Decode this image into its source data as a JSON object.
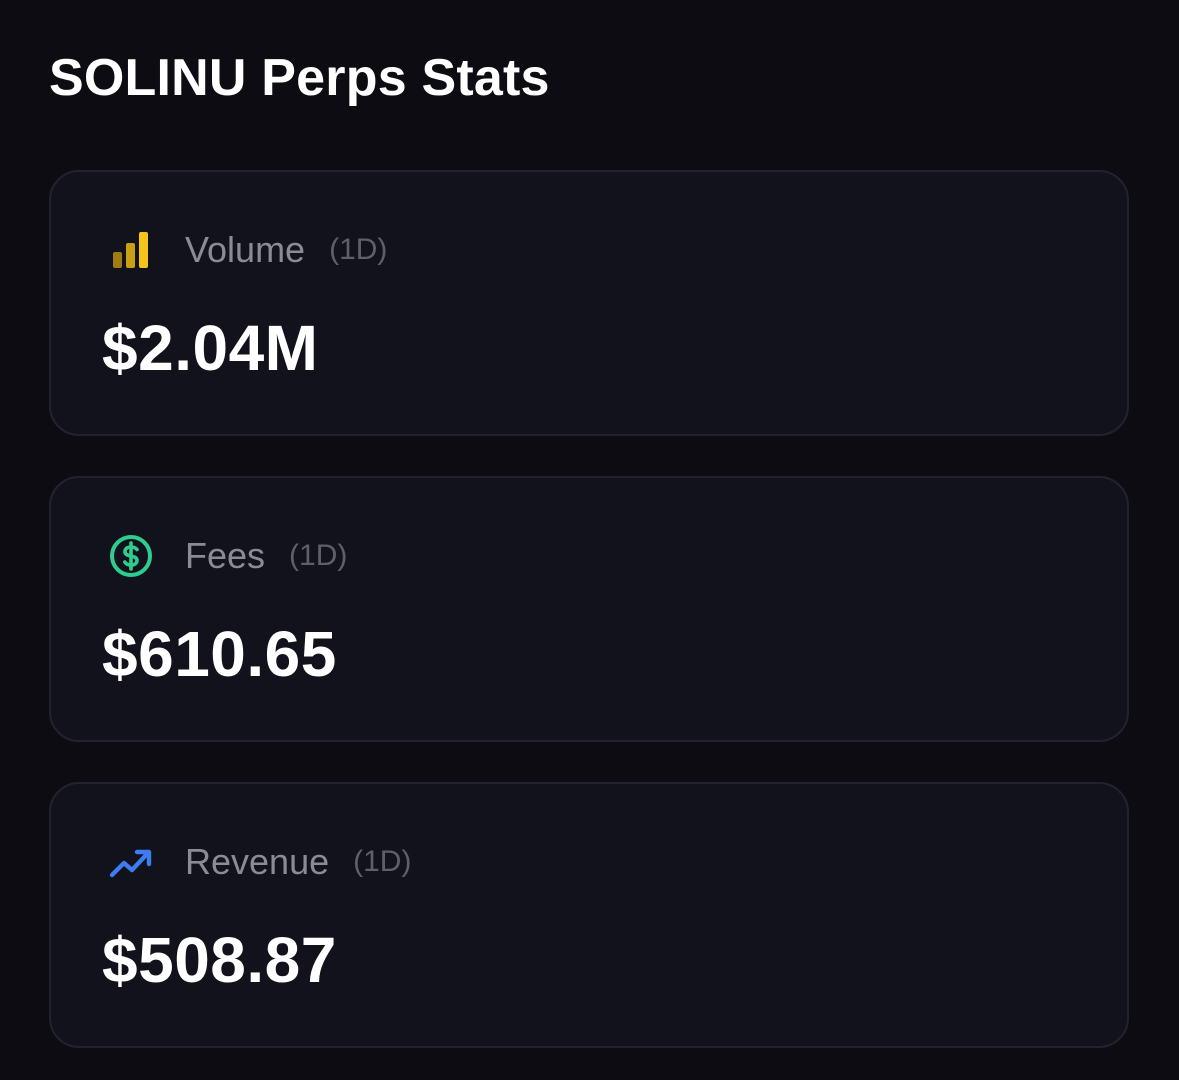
{
  "page": {
    "title": "SOLINU Perps Stats"
  },
  "stats": [
    {
      "label": "Volume",
      "period": "(1D)",
      "value": "$2.04M",
      "icon": "bar-chart-icon",
      "icon_color": "#f5c518"
    },
    {
      "label": "Fees",
      "period": "(1D)",
      "value": "$610.65",
      "icon": "dollar-circle-icon",
      "icon_color": "#2ecc8f"
    },
    {
      "label": "Revenue",
      "period": "(1D)",
      "value": "$508.87",
      "icon": "trending-up-icon",
      "icon_color": "#3d7cf2"
    }
  ]
}
